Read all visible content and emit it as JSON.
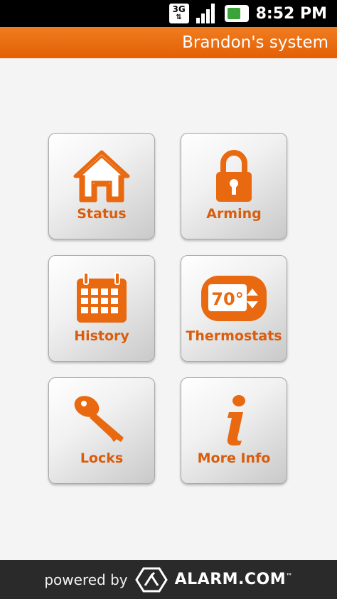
{
  "status_bar": {
    "network": "3G",
    "time": "8:52 PM",
    "icons": [
      "network-3g-icon",
      "signal-icon",
      "battery-icon"
    ]
  },
  "header": {
    "title": "Brandon's system"
  },
  "tiles": [
    {
      "label": "Status",
      "icon": "house-icon"
    },
    {
      "label": "Arming",
      "icon": "padlock-icon"
    },
    {
      "label": "History",
      "icon": "calendar-icon"
    },
    {
      "label": "Thermostats",
      "icon": "thermostat-icon",
      "icon_text": "70°"
    },
    {
      "label": "Locks",
      "icon": "key-icon"
    },
    {
      "label": "More Info",
      "icon": "info-icon"
    }
  ],
  "footer": {
    "powered_by": "powered by",
    "brand": "ALARM.COM",
    "trademark": "™"
  },
  "colors": {
    "accent": "#e8690f",
    "title_bar": "#ed7418",
    "footer_bg": "#2a2a2a",
    "status_bar_bg": "#000000"
  }
}
